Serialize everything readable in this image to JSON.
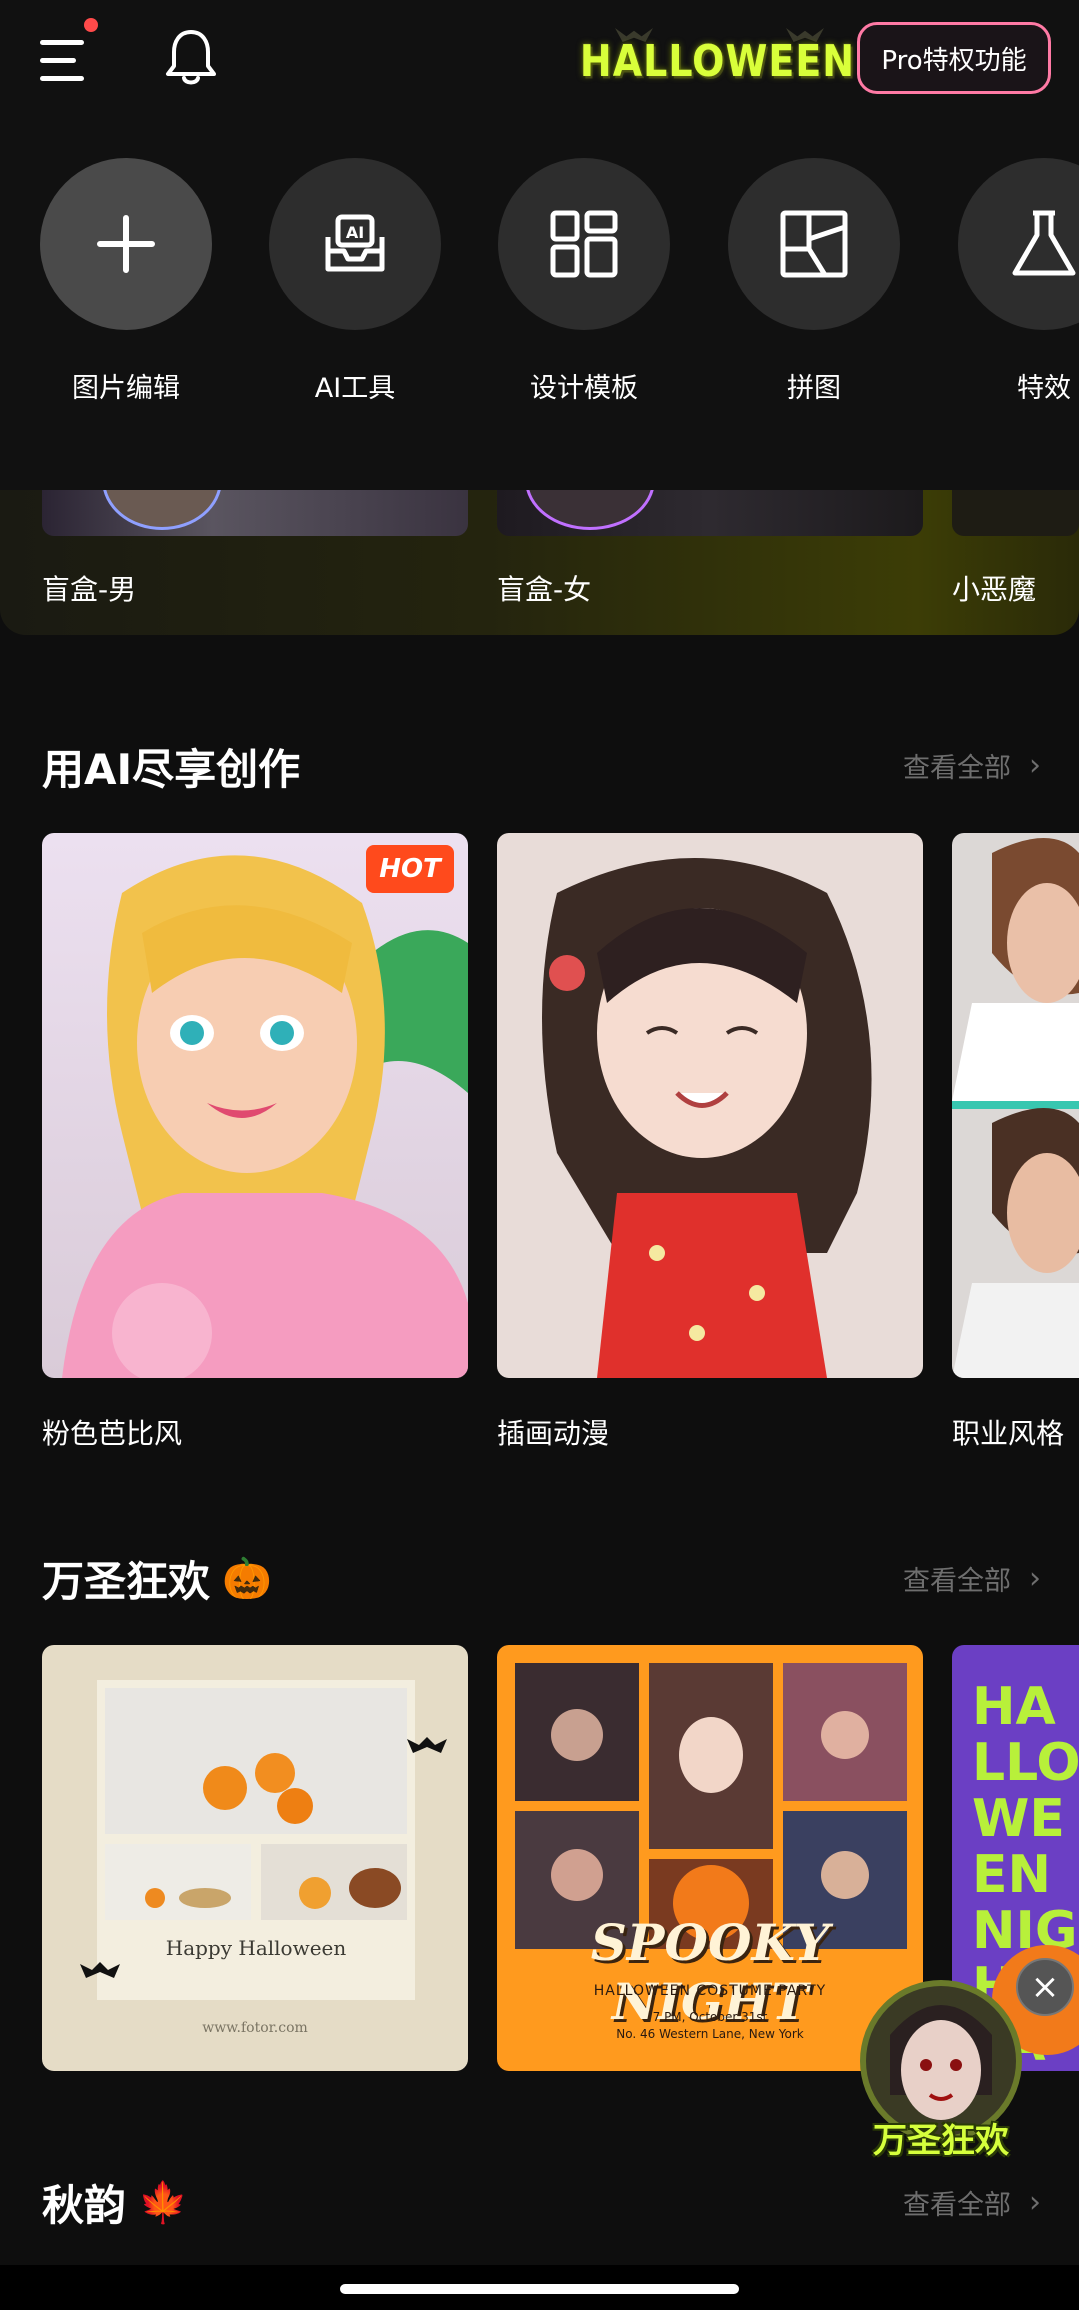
{
  "header": {
    "logo_text": "HALLOWEEN",
    "pro_label": "Pro特权功能"
  },
  "tools": [
    {
      "label": "图片编辑",
      "icon": "plus-icon"
    },
    {
      "label": "AI工具",
      "icon": "ai-inbox-icon"
    },
    {
      "label": "设计模板",
      "icon": "template-grid-icon"
    },
    {
      "label": "拼图",
      "icon": "collage-icon"
    },
    {
      "label": "特效",
      "icon": "flask-icon"
    }
  ],
  "blind_box": [
    {
      "label": "盲盒-男"
    },
    {
      "label": "盲盒-女"
    },
    {
      "label": "小恶魔"
    }
  ],
  "ai_section": {
    "title": "用AI尽享创作",
    "see_all": "查看全部",
    "cards": [
      {
        "label": "粉色芭比风",
        "badge": "HOT"
      },
      {
        "label": "插画动漫"
      },
      {
        "label": "职业风格"
      }
    ]
  },
  "halloween_section": {
    "title": "万圣狂欢",
    "emoji": "🎃",
    "see_all": "查看全部",
    "cards": [
      {
        "caption": "Happy Halloween",
        "site": "www.fotor.com"
      },
      {
        "headline": "SPOOKY NIGHT",
        "sub": "HALLOWEEN COSTUME PARTY",
        "time": "7 PM, October 31st",
        "address": "No. 46 Western Lane, New York"
      },
      {
        "headline": "HALLO WEEN NIGHT PARTY"
      }
    ],
    "float_badge": "万圣狂欢"
  },
  "autumn_section": {
    "title": "秋韵",
    "emoji": "🍁",
    "see_all": "查看全部"
  }
}
